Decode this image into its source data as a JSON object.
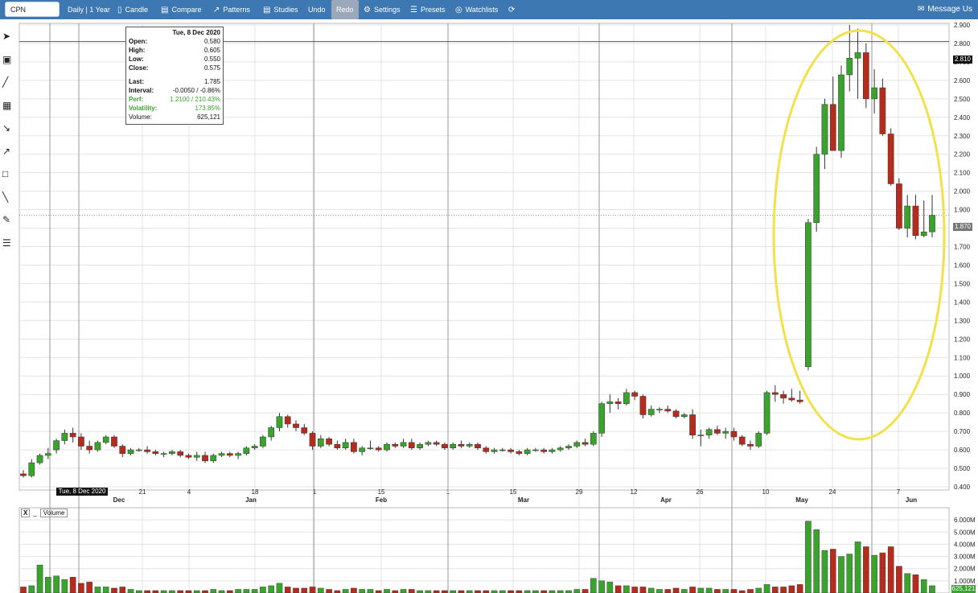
{
  "toolbar": {
    "symbol": "CPN",
    "interval": "Daily | 1 Year",
    "candle": "Candle",
    "compare": "Compare",
    "patterns": "Patterns",
    "studies": "Studies",
    "undo": "Undo",
    "redo": "Redo",
    "settings": "Settings",
    "presets": "Presets",
    "watchlists": "Watchlists",
    "message_us": "Message Us"
  },
  "left_tools": [
    "pointer-icon",
    "crosshair-icon",
    "line-icon",
    "fibonacci-icon",
    "fan-icon",
    "arrow-icon",
    "rectangle-icon",
    "channel-icon",
    "pen-icon",
    "annotation-list-icon"
  ],
  "info_box": {
    "date": "Tue, 8 Dec 2020",
    "open_label": "Open:",
    "open": "0.580",
    "high_label": "High:",
    "high": "0.605",
    "low_label": "Low:",
    "low": "0.550",
    "close_label": "Close:",
    "close": "0.575",
    "last_label": "Last:",
    "last": "1.785",
    "interval_label": "Interval:",
    "interval": "-0.0050 / -0.86%",
    "perf_label": "Perf:",
    "perf": "1.2100 / 210.43%",
    "volatility_label": "Volatility:",
    "volatility": "173.85%",
    "volume_label": "Volume:",
    "volume": "625,121"
  },
  "volume_panel": {
    "close_label": "X",
    "minimize_label": "_",
    "name": "Volume"
  },
  "flags": {
    "high_price": "2.810",
    "last_price": "1.870",
    "cursor_date": "Tue, 8 Dec 2020",
    "last_volume": "625,121"
  },
  "colors": {
    "up": "#3aa32e",
    "down": "#b52b1e",
    "accent": "#3d78b2",
    "highlight_ellipse": "#f3e04b"
  },
  "chart_data": {
    "type": "candlestick",
    "price_axis": {
      "min": 0.4,
      "max": 2.9,
      "ticks": [
        "0.400",
        "0.500",
        "0.600",
        "0.700",
        "0.800",
        "0.900",
        "1.000",
        "1.100",
        "1.200",
        "1.300",
        "1.400",
        "1.500",
        "1.600",
        "1.700",
        "1.800",
        "1.900",
        "2.000",
        "2.100",
        "2.200",
        "2.300",
        "2.400",
        "2.500",
        "2.600",
        "2.700",
        "2.800",
        "2.900"
      ]
    },
    "volume_axis": {
      "min": 0,
      "max": 7000000,
      "ticks": [
        "1.000M",
        "2.000M",
        "3.000M",
        "4.000M",
        "5.000M",
        "6.000M"
      ]
    },
    "date_ticks": [
      "21",
      "4",
      "18",
      "1",
      "15",
      "1",
      "15",
      "29",
      "12",
      "26",
      "10",
      "24",
      "7"
    ],
    "month_labels": [
      "Dec",
      "Jan",
      "Feb",
      "Mar",
      "Apr",
      "May",
      "Jun"
    ],
    "candles": [
      [
        0.47,
        0.49,
        0.45,
        0.46,
        0.5
      ],
      [
        0.46,
        0.55,
        0.45,
        0.53,
        0.6
      ],
      [
        0.53,
        0.58,
        0.52,
        0.57,
        2.3
      ],
      [
        0.57,
        0.61,
        0.55,
        0.58,
        1.3
      ],
      [
        0.6,
        0.66,
        0.58,
        0.65,
        1.4
      ],
      [
        0.65,
        0.71,
        0.63,
        0.69,
        1.1
      ],
      [
        0.69,
        0.72,
        0.64,
        0.67,
        1.3
      ],
      [
        0.67,
        0.69,
        0.6,
        0.62,
        0.8
      ],
      [
        0.62,
        0.65,
        0.58,
        0.6,
        0.9
      ],
      [
        0.6,
        0.65,
        0.59,
        0.64,
        0.5
      ],
      [
        0.64,
        0.68,
        0.63,
        0.67,
        0.5
      ],
      [
        0.67,
        0.68,
        0.61,
        0.62,
        0.4
      ],
      [
        0.62,
        0.63,
        0.56,
        0.58,
        0.5
      ],
      [
        0.58,
        0.61,
        0.57,
        0.6,
        0.3
      ],
      [
        0.6,
        0.61,
        0.59,
        0.6,
        0.2
      ],
      [
        0.6,
        0.62,
        0.58,
        0.59,
        0.2
      ],
      [
        0.59,
        0.6,
        0.57,
        0.58,
        0.2
      ],
      [
        0.58,
        0.59,
        0.56,
        0.58,
        0.2
      ],
      [
        0.58,
        0.6,
        0.57,
        0.59,
        0.2
      ],
      [
        0.59,
        0.6,
        0.56,
        0.57,
        0.2
      ],
      [
        0.57,
        0.58,
        0.55,
        0.56,
        0.2
      ],
      [
        0.56,
        0.59,
        0.54,
        0.57,
        0.2
      ],
      [
        0.57,
        0.59,
        0.53,
        0.54,
        0.2
      ],
      [
        0.54,
        0.58,
        0.53,
        0.57,
        0.3
      ],
      [
        0.57,
        0.59,
        0.56,
        0.58,
        0.2
      ],
      [
        0.58,
        0.59,
        0.56,
        0.57,
        0.2
      ],
      [
        0.57,
        0.59,
        0.55,
        0.58,
        0.3
      ],
      [
        0.58,
        0.62,
        0.57,
        0.61,
        0.3
      ],
      [
        0.61,
        0.63,
        0.6,
        0.62,
        0.3
      ],
      [
        0.62,
        0.68,
        0.61,
        0.67,
        0.5
      ],
      [
        0.67,
        0.73,
        0.65,
        0.72,
        0.6
      ],
      [
        0.72,
        0.8,
        0.7,
        0.78,
        0.8
      ],
      [
        0.78,
        0.79,
        0.72,
        0.74,
        0.5
      ],
      [
        0.74,
        0.76,
        0.7,
        0.72,
        0.4
      ],
      [
        0.72,
        0.74,
        0.68,
        0.69,
        0.4
      ],
      [
        0.69,
        0.7,
        0.6,
        0.62,
        0.5
      ],
      [
        0.62,
        0.68,
        0.61,
        0.66,
        0.4
      ],
      [
        0.66,
        0.67,
        0.62,
        0.63,
        0.3
      ],
      [
        0.63,
        0.65,
        0.6,
        0.61,
        0.2
      ],
      [
        0.61,
        0.66,
        0.6,
        0.64,
        0.3
      ],
      [
        0.64,
        0.66,
        0.58,
        0.59,
        0.4
      ],
      [
        0.59,
        0.62,
        0.57,
        0.61,
        0.3
      ],
      [
        0.61,
        0.65,
        0.6,
        0.61,
        0.3
      ],
      [
        0.61,
        0.62,
        0.59,
        0.6,
        0.2
      ],
      [
        0.6,
        0.64,
        0.59,
        0.63,
        0.3
      ],
      [
        0.63,
        0.64,
        0.61,
        0.62,
        0.2
      ],
      [
        0.62,
        0.66,
        0.61,
        0.64,
        0.3
      ],
      [
        0.64,
        0.66,
        0.6,
        0.61,
        0.3
      ],
      [
        0.61,
        0.64,
        0.6,
        0.63,
        0.2
      ],
      [
        0.63,
        0.65,
        0.62,
        0.64,
        0.2
      ],
      [
        0.64,
        0.65,
        0.62,
        0.63,
        0.2
      ],
      [
        0.63,
        0.64,
        0.6,
        0.61,
        0.2
      ],
      [
        0.61,
        0.64,
        0.6,
        0.63,
        0.2
      ],
      [
        0.63,
        0.65,
        0.61,
        0.62,
        0.2
      ],
      [
        0.62,
        0.64,
        0.61,
        0.63,
        0.2
      ],
      [
        0.63,
        0.64,
        0.6,
        0.61,
        0.2
      ],
      [
        0.61,
        0.62,
        0.58,
        0.59,
        0.2
      ],
      [
        0.59,
        0.61,
        0.58,
        0.6,
        0.2
      ],
      [
        0.6,
        0.61,
        0.59,
        0.6,
        0.2
      ],
      [
        0.6,
        0.61,
        0.58,
        0.59,
        0.2
      ],
      [
        0.59,
        0.6,
        0.57,
        0.58,
        0.2
      ],
      [
        0.58,
        0.61,
        0.57,
        0.6,
        0.2
      ],
      [
        0.6,
        0.61,
        0.59,
        0.6,
        0.2
      ],
      [
        0.6,
        0.61,
        0.58,
        0.59,
        0.2
      ],
      [
        0.59,
        0.61,
        0.58,
        0.6,
        0.2
      ],
      [
        0.6,
        0.62,
        0.59,
        0.61,
        0.2
      ],
      [
        0.61,
        0.63,
        0.6,
        0.62,
        0.2
      ],
      [
        0.62,
        0.65,
        0.61,
        0.64,
        0.3
      ],
      [
        0.64,
        0.66,
        0.62,
        0.63,
        0.3
      ],
      [
        0.63,
        0.7,
        0.62,
        0.69,
        1.2
      ],
      [
        0.69,
        0.86,
        0.67,
        0.85,
        1.0
      ],
      [
        0.85,
        0.9,
        0.8,
        0.86,
        0.9
      ],
      [
        0.86,
        0.88,
        0.82,
        0.85,
        0.6
      ],
      [
        0.85,
        0.93,
        0.84,
        0.91,
        0.6
      ],
      [
        0.91,
        0.92,
        0.87,
        0.89,
        0.5
      ],
      [
        0.89,
        0.9,
        0.77,
        0.79,
        0.5
      ],
      [
        0.79,
        0.84,
        0.78,
        0.82,
        0.4
      ],
      [
        0.82,
        0.83,
        0.8,
        0.82,
        0.3
      ],
      [
        0.82,
        0.84,
        0.8,
        0.81,
        0.3
      ],
      [
        0.81,
        0.82,
        0.77,
        0.78,
        0.4
      ],
      [
        0.78,
        0.8,
        0.77,
        0.79,
        0.3
      ],
      [
        0.79,
        0.82,
        0.66,
        0.68,
        0.5
      ],
      [
        0.68,
        0.71,
        0.62,
        0.68,
        0.4
      ],
      [
        0.68,
        0.72,
        0.66,
        0.71,
        0.4
      ],
      [
        0.71,
        0.73,
        0.68,
        0.69,
        0.3
      ],
      [
        0.69,
        0.72,
        0.66,
        0.7,
        0.3
      ],
      [
        0.7,
        0.72,
        0.65,
        0.67,
        0.3
      ],
      [
        0.67,
        0.68,
        0.62,
        0.63,
        0.2
      ],
      [
        0.63,
        0.65,
        0.6,
        0.62,
        0.3
      ],
      [
        0.62,
        0.7,
        0.61,
        0.69,
        0.4
      ],
      [
        0.69,
        0.92,
        0.68,
        0.91,
        0.7
      ],
      [
        0.91,
        0.95,
        0.86,
        0.9,
        0.5
      ],
      [
        0.9,
        0.92,
        0.85,
        0.88,
        0.5
      ],
      [
        0.88,
        0.93,
        0.86,
        0.87,
        0.6
      ],
      [
        0.87,
        0.92,
        0.85,
        0.86,
        0.7
      ],
      [
        1.05,
        1.85,
        1.03,
        1.83,
        5.9
      ],
      [
        1.83,
        2.24,
        1.78,
        2.2,
        5.2
      ],
      [
        2.2,
        2.5,
        2.12,
        2.47,
        3.5
      ],
      [
        2.47,
        2.62,
        2.36,
        2.22,
        3.6
      ],
      [
        2.22,
        2.68,
        2.18,
        2.63,
        3.0
      ],
      [
        2.63,
        2.9,
        2.54,
        2.72,
        3.2
      ],
      [
        2.72,
        2.88,
        2.5,
        2.75,
        4.2
      ],
      [
        2.75,
        2.8,
        2.45,
        2.5,
        3.8
      ],
      [
        2.5,
        2.66,
        2.42,
        2.56,
        3.1
      ],
      [
        2.56,
        2.61,
        2.3,
        2.31,
        3.3
      ],
      [
        2.31,
        2.34,
        2.03,
        2.04,
        3.8
      ],
      [
        2.04,
        2.07,
        1.79,
        1.8,
        2.2
      ],
      [
        1.8,
        1.98,
        1.75,
        1.92,
        1.6
      ],
      [
        1.92,
        1.98,
        1.74,
        1.76,
        1.5
      ],
      [
        1.76,
        1.95,
        1.75,
        1.78,
        1.1
      ],
      [
        1.78,
        1.98,
        1.75,
        1.87,
        0.6
      ]
    ]
  }
}
